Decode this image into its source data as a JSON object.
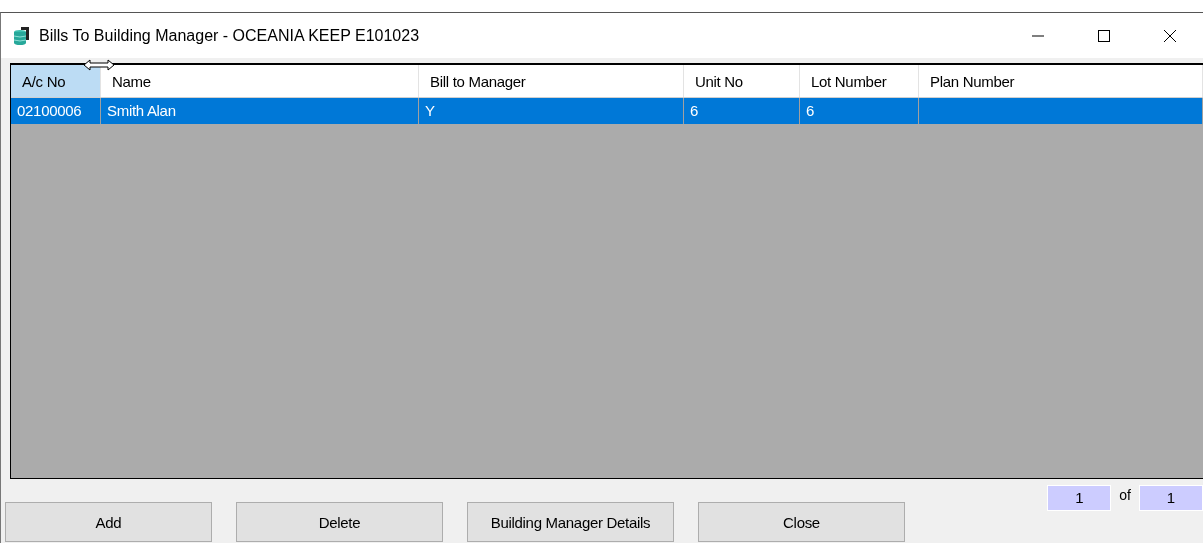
{
  "window": {
    "title": "Bills To Building Manager - OCEANIA KEEP E101023"
  },
  "table": {
    "columns": [
      {
        "label": "A/c No",
        "selected": true
      },
      {
        "label": "Name",
        "selected": false
      },
      {
        "label": "Bill to Manager",
        "selected": false
      },
      {
        "label": "Unit No",
        "selected": false
      },
      {
        "label": "Lot Number",
        "selected": false
      },
      {
        "label": "Plan Number",
        "selected": false
      }
    ],
    "rows": [
      {
        "cells": [
          "02100006",
          "Smith Alan",
          "Y",
          "6",
          "6",
          ""
        ],
        "selected": true
      }
    ]
  },
  "pager": {
    "current": "1",
    "of": "of",
    "total": "1"
  },
  "buttons": [
    "Add",
    "Delete",
    "Building Manager Details",
    "Close"
  ]
}
